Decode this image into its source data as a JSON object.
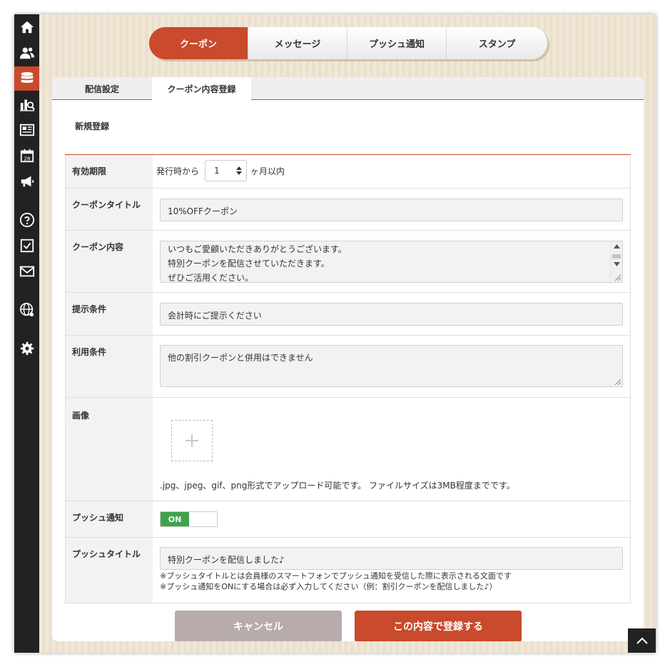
{
  "sidebar": {
    "items": [
      {
        "icon": "home-icon"
      },
      {
        "icon": "users-icon"
      },
      {
        "icon": "database-icon",
        "active": true
      },
      {
        "icon": "analytics-icon"
      },
      {
        "icon": "news-icon"
      },
      {
        "icon": "calendar-icon",
        "badge": "28"
      },
      {
        "icon": "megaphone-icon"
      },
      {
        "icon": "help-icon"
      },
      {
        "icon": "checkbox-icon"
      },
      {
        "icon": "mail-icon"
      },
      {
        "icon": "globe-icon"
      },
      {
        "icon": "gear-icon"
      }
    ]
  },
  "top_tabs": [
    {
      "label": "クーポン",
      "active": true
    },
    {
      "label": "メッセージ"
    },
    {
      "label": "プッシュ通知"
    },
    {
      "label": "スタンプ"
    }
  ],
  "sub_tabs": [
    {
      "label": "配信設定"
    },
    {
      "label": "クーポン内容登録",
      "active": true
    }
  ],
  "section_title": "新規登録",
  "form": {
    "validity": {
      "label": "有効期限",
      "prefix": "発行時から",
      "value": "1",
      "suffix": "ヶ月以内"
    },
    "coupon_title": {
      "label": "クーポンタイトル",
      "value": "10%OFFクーポン"
    },
    "coupon_content": {
      "label": "クーポン内容",
      "lines": [
        "いつもご愛顧いただきありがとうございます。",
        "特別クーポンを配信させていただきます。",
        "ぜひご活用ください。"
      ]
    },
    "presentation": {
      "label": "提示条件",
      "value": "会計時にご提示ください"
    },
    "usage": {
      "label": "利用条件",
      "value": "他の割引クーポンと併用はできません"
    },
    "image": {
      "label": "画像",
      "note": ".jpg、jpeg、gif、png形式でアップロード可能です。 ファイルサイズは3MB程度までです。"
    },
    "push": {
      "label": "プッシュ通知",
      "toggle": "ON"
    },
    "push_title": {
      "label": "プッシュタイトル",
      "value": "特別クーポンを配信しました♪",
      "note1": "※プッシュタイトルとは会員様のスマートフォンでプッシュ通知を受信した際に表示される文面です",
      "note2": "※プッシュ通知をONにする場合は必ず入力してください（例：割引クーポンを配信しました♪）"
    }
  },
  "buttons": {
    "cancel": "キャンセル",
    "submit": "この内容で登録する"
  },
  "colors": {
    "accent": "#c94a2c",
    "sidebar": "#222222",
    "toggle_on": "#3fa24a",
    "cancel": "#b7abab"
  }
}
